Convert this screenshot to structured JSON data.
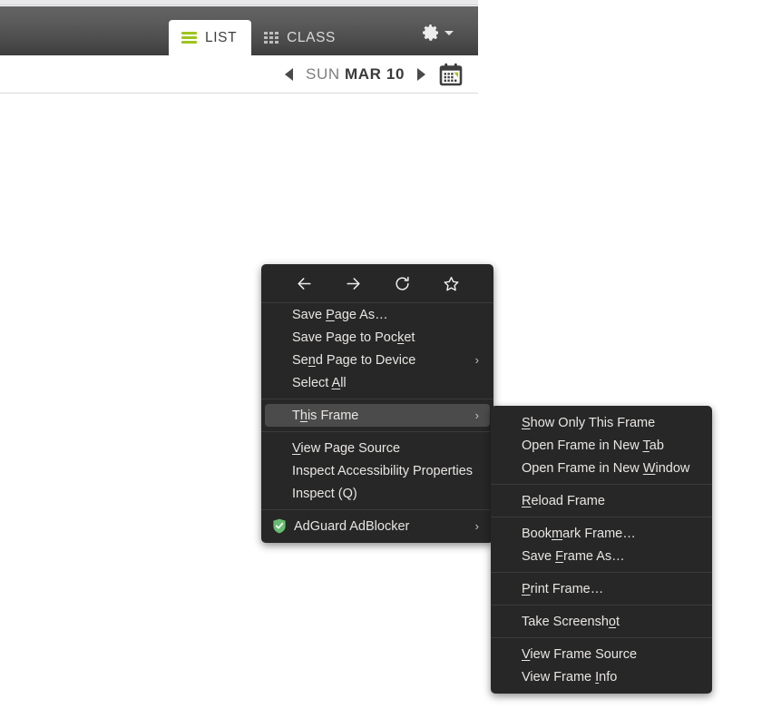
{
  "app": {
    "tabs": [
      {
        "label": "LIST",
        "icon": "list-icon",
        "active": true
      },
      {
        "label": "CLASS",
        "icon": "grid-icon",
        "active": false
      }
    ],
    "settings": {
      "icon": "gear-icon",
      "caret": "chevron-down-icon"
    },
    "date_nav": {
      "prev_icon": "arrow-left-icon",
      "next_icon": "arrow-right-icon",
      "day_of_week": "SUN",
      "date": "MAR 10",
      "calendar_icon": "calendar-icon"
    },
    "colors": {
      "accent_green": "#9ec41c",
      "header_top": "#646464",
      "header_bottom": "#3d3d3d",
      "date_dow": "#7e7e7e",
      "date_value": "#3a3a3a"
    }
  },
  "context_menu": {
    "nav_buttons": [
      {
        "name": "back-icon",
        "glyph": "←"
      },
      {
        "name": "forward-icon",
        "glyph": "→"
      },
      {
        "name": "reload-icon",
        "glyph": "↻"
      },
      {
        "name": "bookmark-star-icon",
        "glyph": "☆"
      }
    ],
    "groups": [
      {
        "items": [
          {
            "label": "Save Page As…",
            "accel": "P",
            "submenu": false
          },
          {
            "label": "Save Page to Pocket",
            "accel": "k",
            "submenu": false
          },
          {
            "label": "Send Page to Device",
            "accel": "n",
            "submenu": true
          },
          {
            "label": "Select All",
            "accel": "A",
            "submenu": false
          }
        ]
      },
      {
        "items": [
          {
            "label": "This Frame",
            "accel": "h",
            "submenu": true,
            "highlighted": true
          }
        ]
      },
      {
        "items": [
          {
            "label": "View Page Source",
            "accel": "V",
            "submenu": false
          },
          {
            "label": "Inspect Accessibility Properties",
            "accel": "",
            "submenu": false
          },
          {
            "label": "Inspect (Q)",
            "accel": "",
            "submenu": false
          }
        ]
      },
      {
        "items": [
          {
            "label": "AdGuard AdBlocker",
            "accel": "",
            "submenu": true,
            "icon": "adguard-shield-icon"
          }
        ]
      }
    ],
    "submenu_arrow_glyph": "›",
    "colors": {
      "background": "#272727",
      "highlight": "#4b4b4b",
      "text": "#e8e6e3",
      "separator": "#3b3b3b",
      "adguard_green": "#68bc71"
    }
  },
  "frame_submenu": {
    "groups": [
      {
        "items": [
          {
            "label": "Show Only This Frame",
            "accel": "S"
          },
          {
            "label": "Open Frame in New Tab",
            "accel": "T"
          },
          {
            "label": "Open Frame in New Window",
            "accel": "W"
          }
        ]
      },
      {
        "items": [
          {
            "label": "Reload Frame",
            "accel": "R"
          }
        ]
      },
      {
        "items": [
          {
            "label": "Bookmark Frame…",
            "accel": "m"
          },
          {
            "label": "Save Frame As…",
            "accel": "F"
          }
        ]
      },
      {
        "items": [
          {
            "label": "Print Frame…",
            "accel": "P"
          }
        ]
      },
      {
        "items": [
          {
            "label": "Take Screenshot",
            "accel": "o"
          }
        ]
      },
      {
        "items": [
          {
            "label": "View Frame Source",
            "accel": "V"
          },
          {
            "label": "View Frame Info",
            "accel": "I"
          }
        ]
      }
    ]
  }
}
